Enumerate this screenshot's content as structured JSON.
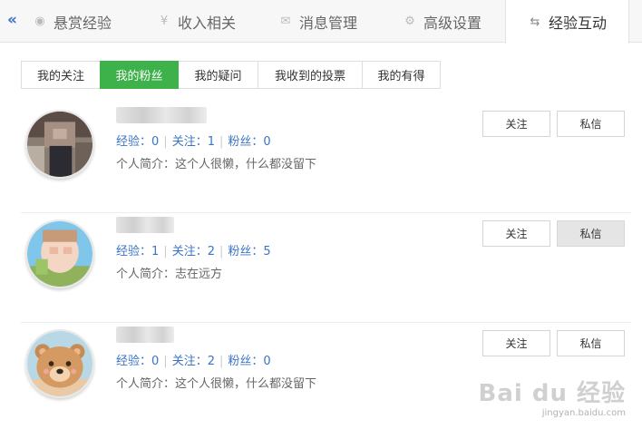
{
  "top_nav": {
    "collapse_glyph": "«",
    "tabs": [
      {
        "label": "悬赏经验",
        "icon": "coin-icon",
        "glyph": "◉"
      },
      {
        "label": "收入相关",
        "icon": "yen-icon",
        "glyph": "¥"
      },
      {
        "label": "消息管理",
        "icon": "mail-icon",
        "glyph": "✉"
      },
      {
        "label": "高级设置",
        "icon": "gear-icon",
        "glyph": "⚙"
      },
      {
        "label": "经验互动",
        "icon": "swap-icon",
        "glyph": "⇆"
      }
    ],
    "active_tab": "经验互动"
  },
  "sub_tabs": {
    "items": [
      "我的关注",
      "我的粉丝",
      "我的疑问",
      "我收到的投票",
      "我的有得"
    ],
    "active": "我的粉丝"
  },
  "users": [
    {
      "stats": {
        "exp_label": "经验：",
        "exp": "0",
        "follow_label": "关注：",
        "follow": "1",
        "fans_label": "粉丝：",
        "fans": "0"
      },
      "bio": "个人简介：这个人很懒，什么都没留下",
      "follow_btn": "关注",
      "msg_btn": "私信"
    },
    {
      "stats": {
        "exp_label": "经验：",
        "exp": "1",
        "follow_label": "关注：",
        "follow": "2",
        "fans_label": "粉丝：",
        "fans": "5"
      },
      "bio": "个人简介：志在远方",
      "follow_btn": "关注",
      "msg_btn": "私信"
    },
    {
      "stats": {
        "exp_label": "经验：",
        "exp": "0",
        "follow_label": "关注：",
        "follow": "2",
        "fans_label": "粉丝：",
        "fans": "0"
      },
      "bio": "个人简介：这个人很懒，什么都没留下",
      "follow_btn": "关注",
      "msg_btn": "私信"
    }
  ],
  "colors": {
    "active_green": "#3db24b",
    "link_blue": "#3b74c4"
  },
  "watermark": {
    "logo": "Bai du 经验",
    "sub": "jingyan.baidu.com"
  }
}
